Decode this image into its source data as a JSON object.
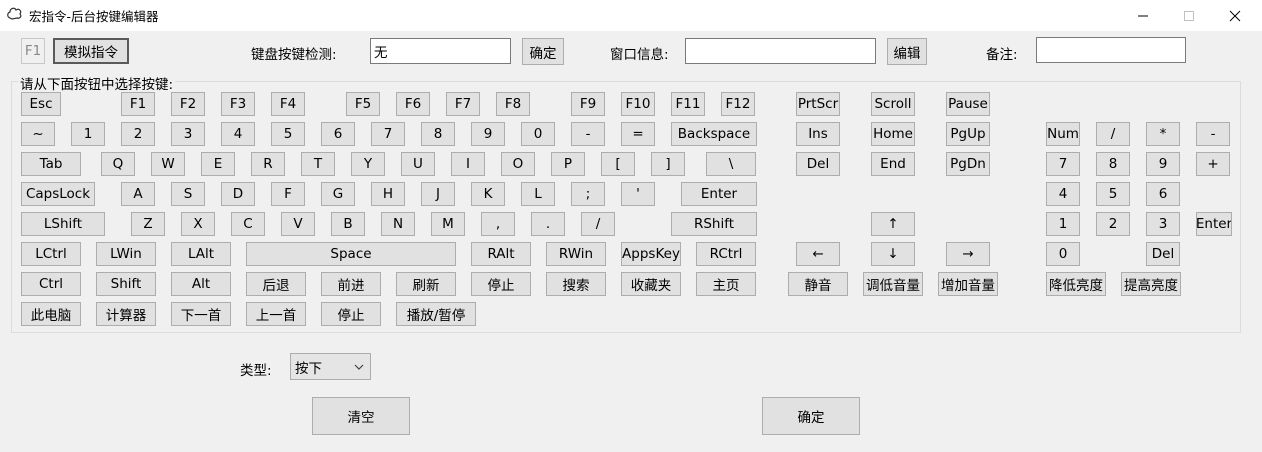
{
  "window": {
    "title": "宏指令-后台按键编辑器"
  },
  "top": {
    "f1_label": "F1",
    "simulate_btn": "模拟指令",
    "detect_label": "键盘按键检测:",
    "detect_value": "无",
    "confirm_btn": "确定",
    "window_info_label": "窗口信息:",
    "window_info_value": "",
    "edit_btn": "编辑",
    "note_label": "备注:",
    "note_value": ""
  },
  "group": {
    "title": "请从下面按钮中选择按键:"
  },
  "keys": {
    "row1": [
      "Esc",
      "F1",
      "F2",
      "F3",
      "F4",
      "F5",
      "F6",
      "F7",
      "F8",
      "F9",
      "F10",
      "F11",
      "F12"
    ],
    "row1_nav": [
      "PrtScr",
      "Scroll",
      "Pause"
    ],
    "row2": [
      "~",
      "1",
      "2",
      "3",
      "4",
      "5",
      "6",
      "7",
      "8",
      "9",
      "0",
      "-",
      "=",
      "Backspace"
    ],
    "row2_nav": [
      "Ins",
      "Home",
      "PgUp"
    ],
    "row2_num": [
      "Num",
      "/",
      "*",
      "-"
    ],
    "row3": [
      "Tab",
      "Q",
      "W",
      "E",
      "R",
      "T",
      "Y",
      "U",
      "I",
      "O",
      "P",
      "[",
      "]",
      "\\"
    ],
    "row3_nav": [
      "Del",
      "End",
      "PgDn"
    ],
    "row3_num": [
      "7",
      "8",
      "9",
      "+"
    ],
    "row4": [
      "CapsLock",
      "A",
      "S",
      "D",
      "F",
      "G",
      "H",
      "J",
      "K",
      "L",
      ";",
      "'",
      "Enter"
    ],
    "row4_num": [
      "4",
      "5",
      "6"
    ],
    "row5": [
      "LShift",
      "Z",
      "X",
      "C",
      "V",
      "B",
      "N",
      "M",
      ",",
      ".",
      "/",
      "RShift"
    ],
    "row5_nav": [
      "↑"
    ],
    "row5_num": [
      "1",
      "2",
      "3",
      "Enter"
    ],
    "row6": [
      "LCtrl",
      "LWin",
      "LAlt",
      "Space",
      "RAlt",
      "RWin",
      "AppsKey",
      "RCtrl"
    ],
    "row6_nav": [
      "←",
      "↓",
      "→"
    ],
    "row6_num": [
      "0",
      "Del"
    ],
    "row7": [
      "Ctrl",
      "Shift",
      "Alt",
      "后退",
      "前进",
      "刷新",
      "停止",
      "搜索",
      "收藏夹",
      "主页"
    ],
    "row7_media": [
      "静音",
      "调低音量",
      "增加音量"
    ],
    "row7_bright": [
      "降低亮度",
      "提高亮度"
    ],
    "row8": [
      "此电脑",
      "计算器",
      "下一首",
      "上一首",
      "停止",
      "播放/暂停"
    ]
  },
  "bottom": {
    "type_label": "类型:",
    "type_value": "按下",
    "clear_btn": "清空",
    "ok_btn": "确定"
  },
  "icons": {
    "app": "squiggle-app-icon",
    "minimize": "minimize-icon",
    "maximize": "maximize-icon",
    "close": "close-icon",
    "dropdown": "chevron-down-icon"
  }
}
